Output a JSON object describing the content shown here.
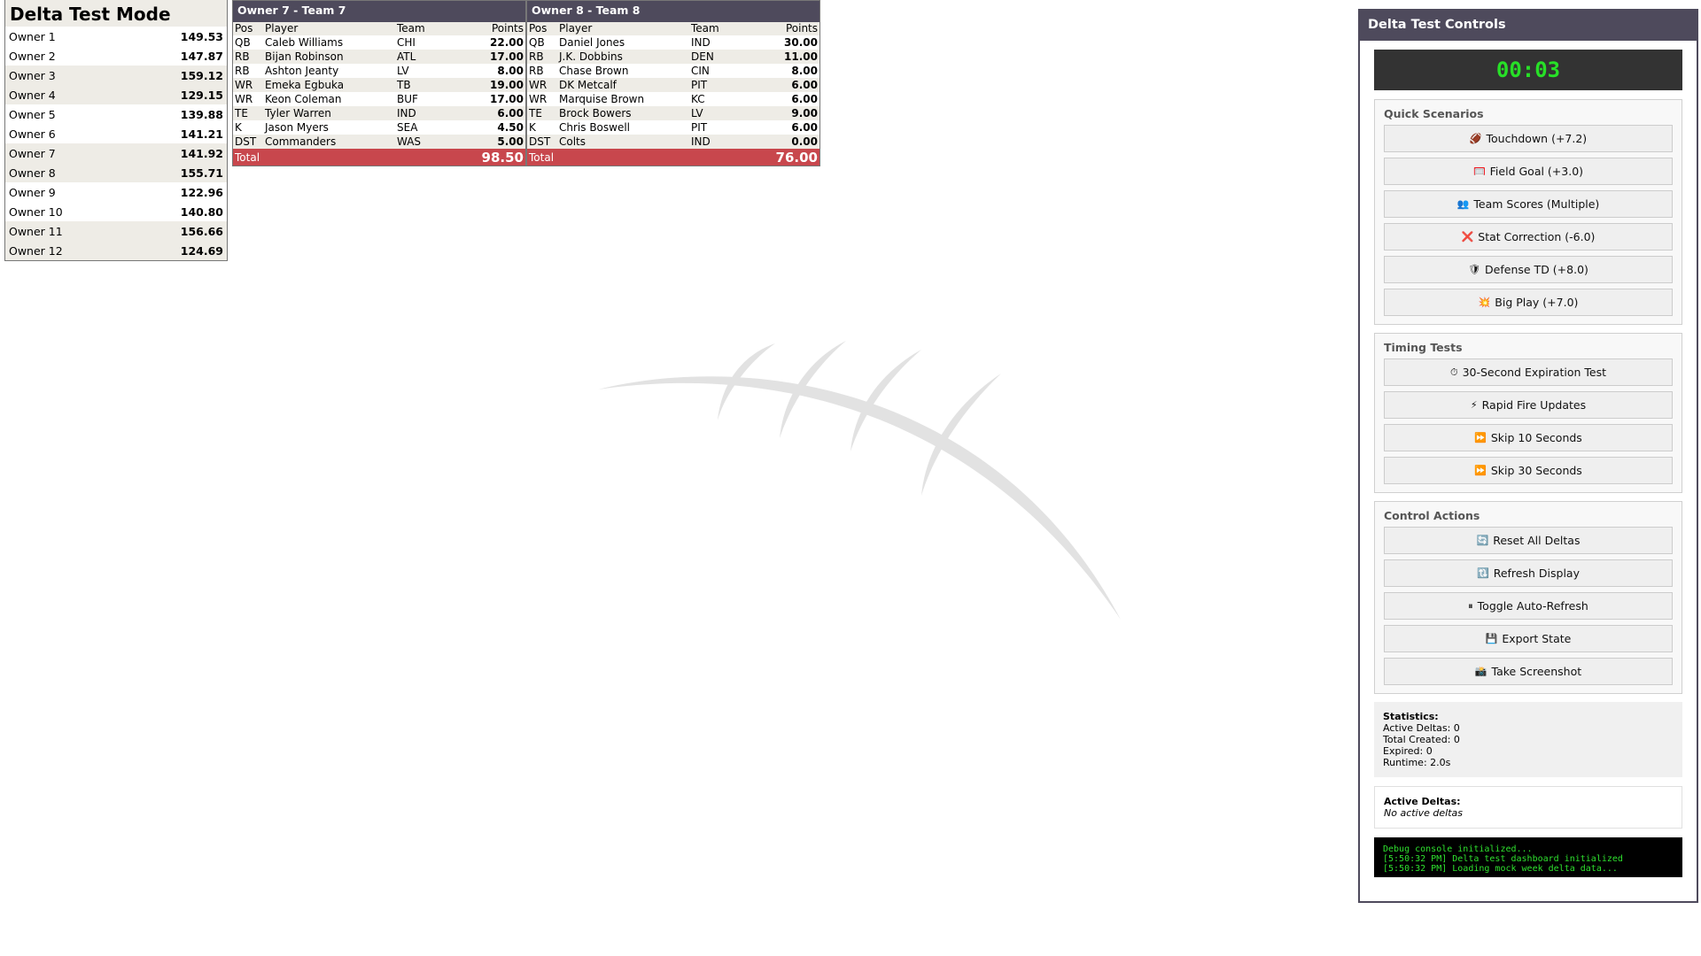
{
  "standings": {
    "title": "Delta Test Mode",
    "rows": [
      {
        "owner": "Owner 1",
        "score": "149.53"
      },
      {
        "owner": "Owner 2",
        "score": "147.87"
      },
      {
        "owner": "Owner 3",
        "score": "159.12"
      },
      {
        "owner": "Owner 4",
        "score": "129.15"
      },
      {
        "owner": "Owner 5",
        "score": "139.88"
      },
      {
        "owner": "Owner 6",
        "score": "141.21"
      },
      {
        "owner": "Owner 7",
        "score": "141.92"
      },
      {
        "owner": "Owner 8",
        "score": "155.71"
      },
      {
        "owner": "Owner 9",
        "score": "122.96"
      },
      {
        "owner": "Owner 10",
        "score": "140.80"
      },
      {
        "owner": "Owner 11",
        "score": "156.66"
      },
      {
        "owner": "Owner 12",
        "score": "124.69"
      }
    ]
  },
  "teams": [
    {
      "header": "Owner 7 - Team 7",
      "columns": {
        "pos": "Pos",
        "player": "Player",
        "team": "Team",
        "points": "Points"
      },
      "players": [
        {
          "pos": "QB",
          "player": "Caleb Williams",
          "team": "CHI",
          "points": "22.00"
        },
        {
          "pos": "RB",
          "player": "Bijan Robinson",
          "team": "ATL",
          "points": "17.00"
        },
        {
          "pos": "RB",
          "player": "Ashton Jeanty",
          "team": "LV",
          "points": "8.00"
        },
        {
          "pos": "WR",
          "player": "Emeka Egbuka",
          "team": "TB",
          "points": "19.00"
        },
        {
          "pos": "WR",
          "player": "Keon Coleman",
          "team": "BUF",
          "points": "17.00"
        },
        {
          "pos": "TE",
          "player": "Tyler Warren",
          "team": "IND",
          "points": "6.00"
        },
        {
          "pos": "K",
          "player": "Jason Myers",
          "team": "SEA",
          "points": "4.50"
        },
        {
          "pos": "DST",
          "player": "Commanders",
          "team": "WAS",
          "points": "5.00"
        }
      ],
      "total_label": "Total",
      "total": "98.50"
    },
    {
      "header": "Owner 8 - Team 8",
      "columns": {
        "pos": "Pos",
        "player": "Player",
        "team": "Team",
        "points": "Points"
      },
      "players": [
        {
          "pos": "QB",
          "player": "Daniel Jones",
          "team": "IND",
          "points": "30.00"
        },
        {
          "pos": "RB",
          "player": "J.K. Dobbins",
          "team": "DEN",
          "points": "11.00"
        },
        {
          "pos": "RB",
          "player": "Chase Brown",
          "team": "CIN",
          "points": "8.00"
        },
        {
          "pos": "WR",
          "player": "DK Metcalf",
          "team": "PIT",
          "points": "6.00"
        },
        {
          "pos": "WR",
          "player": "Marquise Brown",
          "team": "KC",
          "points": "6.00"
        },
        {
          "pos": "TE",
          "player": "Brock Bowers",
          "team": "LV",
          "points": "9.00"
        },
        {
          "pos": "K",
          "player": "Chris Boswell",
          "team": "PIT",
          "points": "6.00"
        },
        {
          "pos": "DST",
          "player": "Colts",
          "team": "IND",
          "points": "0.00"
        }
      ],
      "total_label": "Total",
      "total": "76.00"
    }
  ],
  "controls": {
    "title": "Delta Test Controls",
    "timer": "00:03",
    "quick": {
      "title": "Quick Scenarios",
      "buttons": [
        {
          "icon": "football-icon",
          "glyph": "🏈",
          "label": "Touchdown (+7.2)"
        },
        {
          "icon": "goal-icon",
          "glyph": "🥅",
          "label": "Field Goal (+3.0)"
        },
        {
          "icon": "people-icon",
          "glyph": "👥",
          "label": "Team Scores (Multiple)"
        },
        {
          "icon": "cross-icon",
          "glyph": "❌",
          "label": "Stat Correction (-6.0)"
        },
        {
          "icon": "shield-icon",
          "glyph": "🛡",
          "label": "Defense TD (+8.0)"
        },
        {
          "icon": "collision-icon",
          "glyph": "💥",
          "label": "Big Play (+7.0)"
        }
      ]
    },
    "timing": {
      "title": "Timing Tests",
      "buttons": [
        {
          "icon": "stopwatch-icon",
          "glyph": "⏱",
          "label": "30-Second Expiration Test"
        },
        {
          "icon": "lightning-icon",
          "glyph": "⚡",
          "label": "Rapid Fire Updates"
        },
        {
          "icon": "fast-forward-icon",
          "glyph": "⏩",
          "label": "Skip 10 Seconds"
        },
        {
          "icon": "fast-forward-icon",
          "glyph": "⏩",
          "label": "Skip 30 Seconds"
        }
      ]
    },
    "actions": {
      "title": "Control Actions",
      "buttons": [
        {
          "icon": "cycle-icon",
          "glyph": "🔄",
          "label": "Reset All Deltas"
        },
        {
          "icon": "refresh-icon",
          "glyph": "🔃",
          "label": "Refresh Display"
        },
        {
          "icon": "pause-icon",
          "glyph": "⏸",
          "label": "Toggle Auto-Refresh"
        },
        {
          "icon": "floppy-disk-icon",
          "glyph": "💾",
          "label": "Export State"
        },
        {
          "icon": "camera-icon",
          "glyph": "📸",
          "label": "Take Screenshot"
        }
      ]
    },
    "stats": {
      "title": "Statistics:",
      "lines": [
        "Active Deltas: 0",
        "Total Created: 0",
        "Expired: 0",
        "Runtime: 2.0s"
      ]
    },
    "active": {
      "title": "Active Deltas:",
      "empty": "No active deltas"
    },
    "console": [
      "Debug console initialized...",
      "[5:50:32 PM] Delta test dashboard initialized",
      "[5:50:32 PM] Loading mock week delta data..."
    ]
  },
  "colors": {
    "header_bg": "#4e4a5c",
    "total_bg": "#c8474d",
    "timer_text": "#27e027",
    "stripe": "#eeece6"
  }
}
